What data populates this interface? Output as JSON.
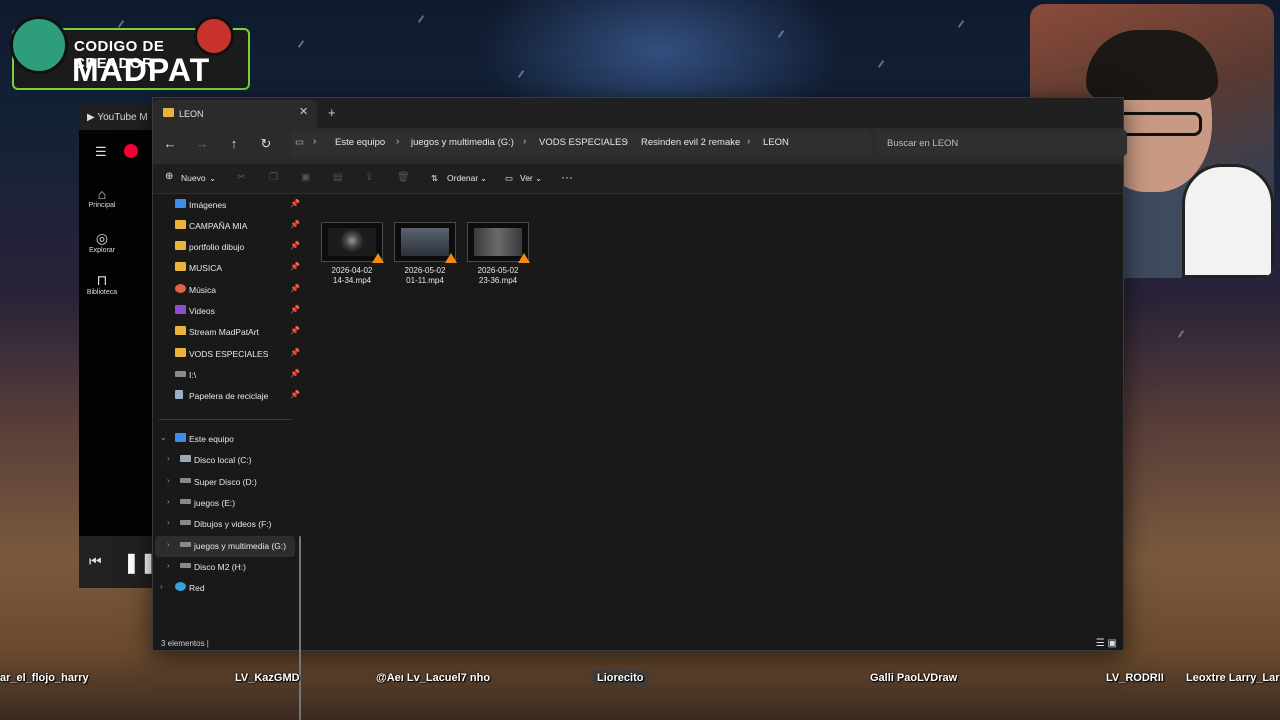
{
  "overlay": {
    "logo_line1": "CODIGO DE CREADOR",
    "logo_line2": "MADPAT",
    "chat_names": [
      "ar_el_flojo_harry",
      "LV_KazGMD",
      "@Aeı Lv_Lacuel7 nho",
      "Liorecito",
      "Galli PaoLVDraw",
      "LV_RODRII",
      "Leoxtre Larry_Lar"
    ]
  },
  "ytmusic": {
    "tab_title": "YouTube M",
    "nav": [
      "Principal",
      "Explorar",
      "Biblioteca"
    ]
  },
  "explorer": {
    "tab_title": "LEON",
    "breadcrumb": [
      "Este equipo",
      "juegos y multimedia (G:)",
      "VODS ESPECIALES",
      "Resinden evil 2 remake",
      "LEON"
    ],
    "search_placeholder": "Buscar en LEON",
    "commands": {
      "new": "Nuevo",
      "sort": "Ordenar",
      "view": "Ver",
      "more": "···"
    },
    "quick_access": [
      "Imágenes",
      "CAMPAÑA MIA",
      "portfolio dibujo",
      "MUSICA",
      "Música",
      "Videos",
      "Stream MadPatArt",
      "VODS ESPECIALES",
      "I:\\",
      "Papelera de reciclaje"
    ],
    "this_pc": "Este equipo",
    "drives": [
      "Disco local (C:)",
      "Super Disco (D:)",
      "juegos (E:)",
      "Dibujos y videos (F:)",
      "juegos y multimedia (G:)",
      "Disco M2 (H:)"
    ],
    "network": "Red",
    "files": [
      {
        "name_line1": "2026-04-02",
        "name_line2": "14-34.mp4"
      },
      {
        "name_line1": "2026-05-02",
        "name_line2": "01-11.mp4"
      },
      {
        "name_line1": "2026-05-02",
        "name_line2": "23-36.mp4"
      }
    ],
    "status": "3 elementos  |",
    "selected_drive": "juegos y multimedia (G:)"
  },
  "colors": {
    "folder": "#e8b43a",
    "accent_green": "#7cd13a",
    "vlc": "#f08a12",
    "yt_red": "#ff0033"
  }
}
